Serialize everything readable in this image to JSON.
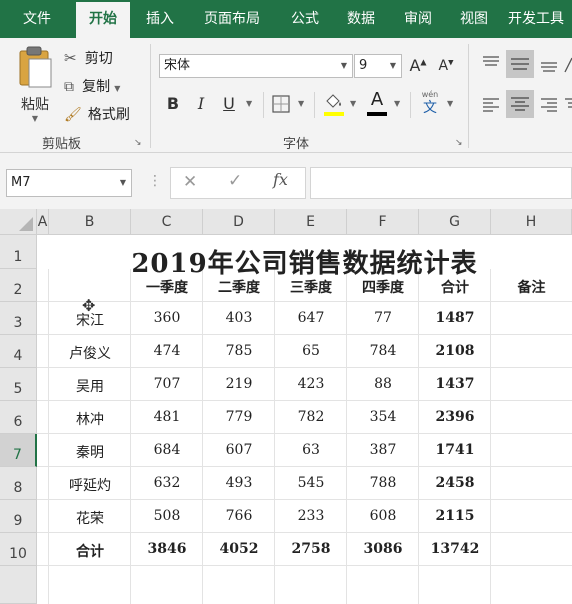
{
  "ribbon_tabs": [
    "文件",
    "开始",
    "插入",
    "页面布局",
    "公式",
    "数据",
    "审阅",
    "视图",
    "开发工具"
  ],
  "active_tab": "开始",
  "clipboard": {
    "paste_label": "粘贴",
    "cut_label": "剪切",
    "copy_label": "复制",
    "format_painter_label": "格式刷",
    "group_label": "剪贴板"
  },
  "font": {
    "family": "宋体",
    "size": "9",
    "group_label": "字体",
    "bold": "B",
    "italic": "I",
    "underline": "U",
    "grow": "A",
    "shrink": "A",
    "font_color_glyph": "A",
    "phonetic_label": "wén",
    "phonetic_glyph": "文"
  },
  "formula_bar": {
    "name_box": "M7",
    "fx_label": "fx",
    "formula": ""
  },
  "colors": {
    "brand_green": "#217346",
    "font_color_bar": "#000000",
    "fill_color_bar": "#ffff00"
  },
  "sheet": {
    "columns": [
      "A",
      "B",
      "C",
      "D",
      "E",
      "F",
      "G",
      "H"
    ],
    "rows": [
      "1",
      "2",
      "3",
      "4",
      "5",
      "6",
      "7",
      "8",
      "9",
      "10"
    ],
    "selected_row": "7",
    "title": "2019年公司销售数据统计表",
    "headers": [
      "一季度",
      "二季度",
      "三季度",
      "四季度",
      "合计",
      "备注"
    ],
    "data": [
      {
        "name": "宋江",
        "q1": "360",
        "q2": "403",
        "q3": "647",
        "q4": "77",
        "total": "1487"
      },
      {
        "name": "卢俊义",
        "q1": "474",
        "q2": "785",
        "q3": "65",
        "q4": "784",
        "total": "2108"
      },
      {
        "name": "吴用",
        "q1": "707",
        "q2": "219",
        "q3": "423",
        "q4": "88",
        "total": "1437"
      },
      {
        "name": "林冲",
        "q1": "481",
        "q2": "779",
        "q3": "782",
        "q4": "354",
        "total": "2396"
      },
      {
        "name": "秦明",
        "q1": "684",
        "q2": "607",
        "q3": "63",
        "q4": "387",
        "total": "1741"
      },
      {
        "name": "呼延灼",
        "q1": "632",
        "q2": "493",
        "q3": "545",
        "q4": "788",
        "total": "2458"
      },
      {
        "name": "花荣",
        "q1": "508",
        "q2": "766",
        "q3": "233",
        "q4": "608",
        "total": "2115"
      }
    ],
    "totals": {
      "label": "合计",
      "q1": "3846",
      "q2": "4052",
      "q3": "2758",
      "q4": "3086",
      "total": "13742"
    }
  }
}
